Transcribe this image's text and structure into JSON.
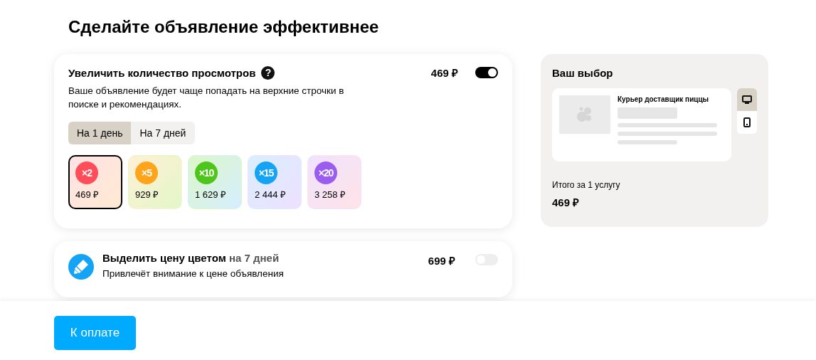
{
  "title": "Сделайте объявление эффективнее",
  "boost": {
    "title": "Увеличить количество просмотров",
    "help": "?",
    "price": "469 ₽",
    "on": true,
    "description": "Ваше объявление будет чаще попадать на верхние строчки в поиске и рекомендациях.",
    "tabs": [
      {
        "label": "На 1 день",
        "selected": true
      },
      {
        "label": "На 7 дней",
        "selected": false
      }
    ],
    "options": [
      {
        "badge": "×2",
        "price": "469 ₽",
        "color": "#ff4d5a",
        "selected": true
      },
      {
        "badge": "×5",
        "price": "929 ₽",
        "color": "#ffa41b",
        "selected": false
      },
      {
        "badge": "×10",
        "price": "1 629 ₽",
        "color": "#4dc51b",
        "selected": false
      },
      {
        "badge": "×15",
        "price": "2 444 ₽",
        "color": "#14a3f5",
        "selected": false
      },
      {
        "badge": "×20",
        "price": "3 258 ₽",
        "color": "#9b5cf0",
        "selected": false
      }
    ]
  },
  "highlight": {
    "title": "Выделить цену цветом",
    "period": "на 7 дней",
    "price": "699 ₽",
    "on": false,
    "description": "Привлечёт внимание к цене объявления"
  },
  "summary": {
    "title": "Ваш выбор",
    "ad_title": "Курьер доставщик пиццы",
    "devices": [
      {
        "kind": "desktop",
        "selected": true
      },
      {
        "kind": "phone",
        "selected": false
      }
    ],
    "total_label": "Итого за 1 услугу",
    "total": "469 ₽"
  },
  "pay_button": "К оплате"
}
